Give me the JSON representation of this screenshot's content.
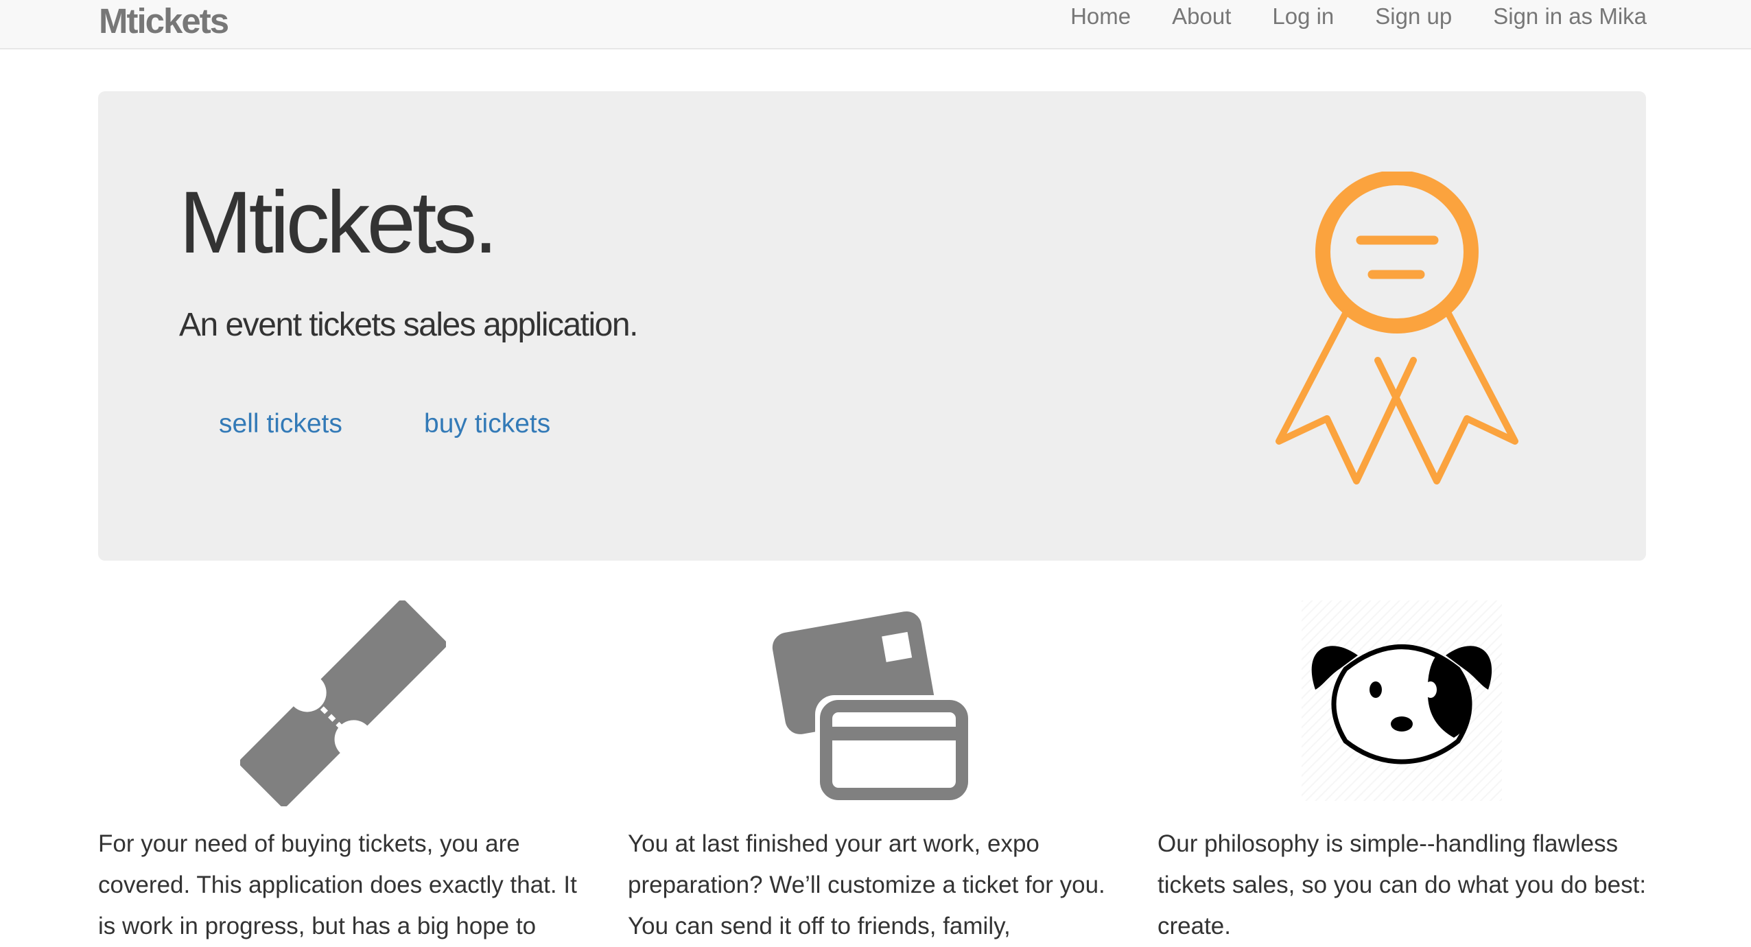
{
  "navbar": {
    "brand": "Mtickets",
    "links": [
      "Home",
      "About",
      "Log in",
      "Sign up",
      "Sign in as Mika"
    ]
  },
  "hero": {
    "title": "Mtickets.",
    "subtitle": "An event tickets sales application.",
    "sell_label": "sell tickets",
    "buy_label": "buy tickets",
    "ribbon_color": "#fba33e"
  },
  "features": [
    {
      "icon": "ticket-icon",
      "text": "For your need of buying tickets, you are covered. This application does exactly that. It is work in progress, but has a big hope to"
    },
    {
      "icon": "credit-cards-icon",
      "text": "You at last finished your art work, expo preparation? We’ll customize a ticket for you. You can send it off to friends, family,"
    },
    {
      "icon": "dog-icon",
      "text": "Our philosophy is simple--handling flawless tickets sales, so you can do what you do best: create."
    }
  ],
  "colors": {
    "navbar_bg": "#f8f8f8",
    "jumbotron_bg": "#eeeeee",
    "link": "#337ab7",
    "nav_text": "#777777",
    "icon_gray": "#808080"
  }
}
